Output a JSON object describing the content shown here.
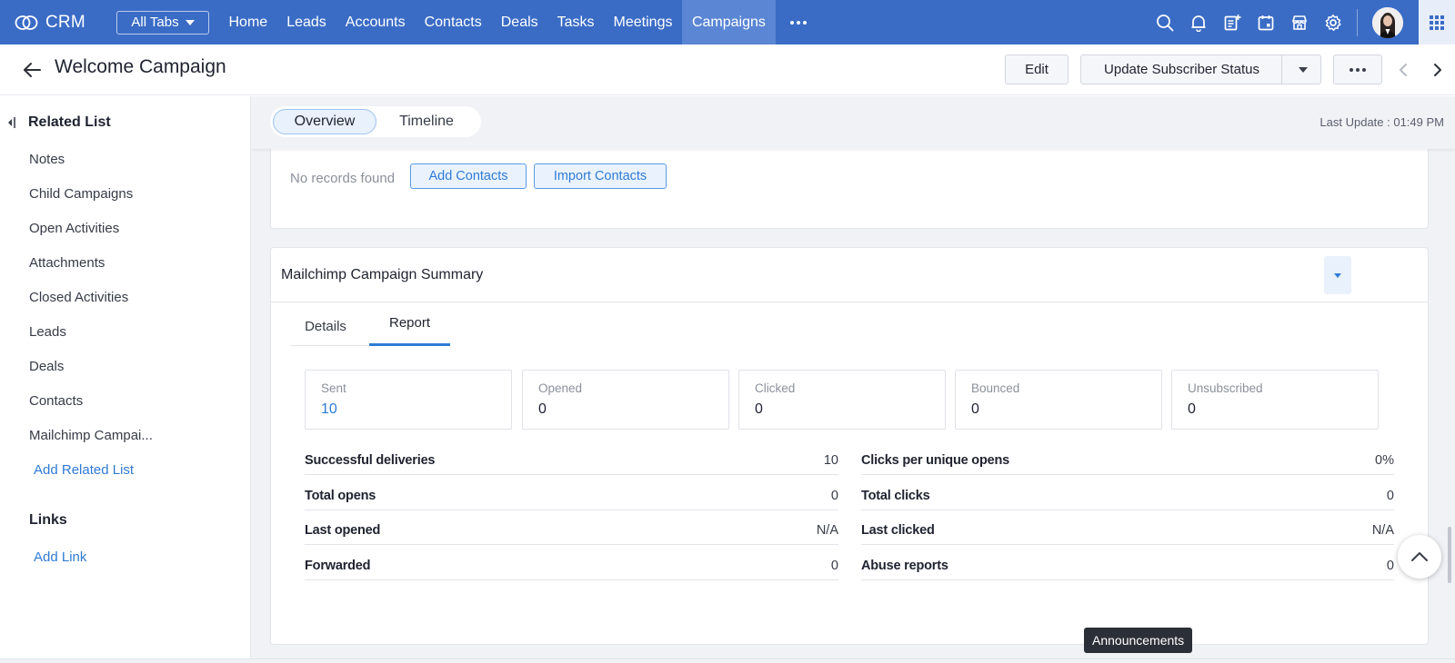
{
  "nav": {
    "brand": "CRM",
    "all_tabs": "All Tabs",
    "links": [
      "Home",
      "Leads",
      "Accounts",
      "Contacts",
      "Deals",
      "Tasks",
      "Meetings",
      "Campaigns"
    ],
    "active": "Campaigns",
    "icons": [
      "search-icon",
      "bell-icon",
      "add-note-icon",
      "calendar-icon",
      "marketplace-icon",
      "settings-icon"
    ],
    "colors": {
      "bar": "#3a6cc6",
      "active_tab": "#5a86d4"
    }
  },
  "record": {
    "title": "Welcome Campaign",
    "edit": "Edit",
    "update_status": "Update Subscriber Status"
  },
  "sidebar": {
    "title": "Related List",
    "items": [
      "Notes",
      "Child Campaigns",
      "Open Activities",
      "Attachments",
      "Closed Activities",
      "Leads",
      "Deals",
      "Contacts",
      "Mailchimp Campai..."
    ],
    "add_related": "Add Related List",
    "links_title": "Links",
    "add_link": "Add Link"
  },
  "main": {
    "tabs": [
      "Overview",
      "Timeline"
    ],
    "active_tab": "Overview",
    "last_update": "Last Update : 01:49 PM",
    "contacts_section": {
      "empty": "No records found",
      "add_contacts": "Add Contacts",
      "import_contacts": "Import Contacts"
    },
    "summary": {
      "title": "Mailchimp Campaign Summary",
      "tabs": [
        "Details",
        "Report"
      ],
      "active_tab": "Report",
      "stats": [
        {
          "label": "Sent",
          "value": "10"
        },
        {
          "label": "Opened",
          "value": "0"
        },
        {
          "label": "Clicked",
          "value": "0"
        },
        {
          "label": "Bounced",
          "value": "0"
        },
        {
          "label": "Unsubscribed",
          "value": "0"
        }
      ],
      "left_metrics": [
        {
          "label": "Successful deliveries",
          "value": "10"
        },
        {
          "label": "Total opens",
          "value": "0"
        },
        {
          "label": "Last opened",
          "value": "N/A"
        },
        {
          "label": "Forwarded",
          "value": "0"
        }
      ],
      "right_metrics": [
        {
          "label": "Clicks per unique opens",
          "value": "0%"
        },
        {
          "label": "Total clicks",
          "value": "0"
        },
        {
          "label": "Last clicked",
          "value": "N/A"
        },
        {
          "label": "Abuse reports",
          "value": "0"
        }
      ]
    }
  },
  "tooltip": "Announcements"
}
